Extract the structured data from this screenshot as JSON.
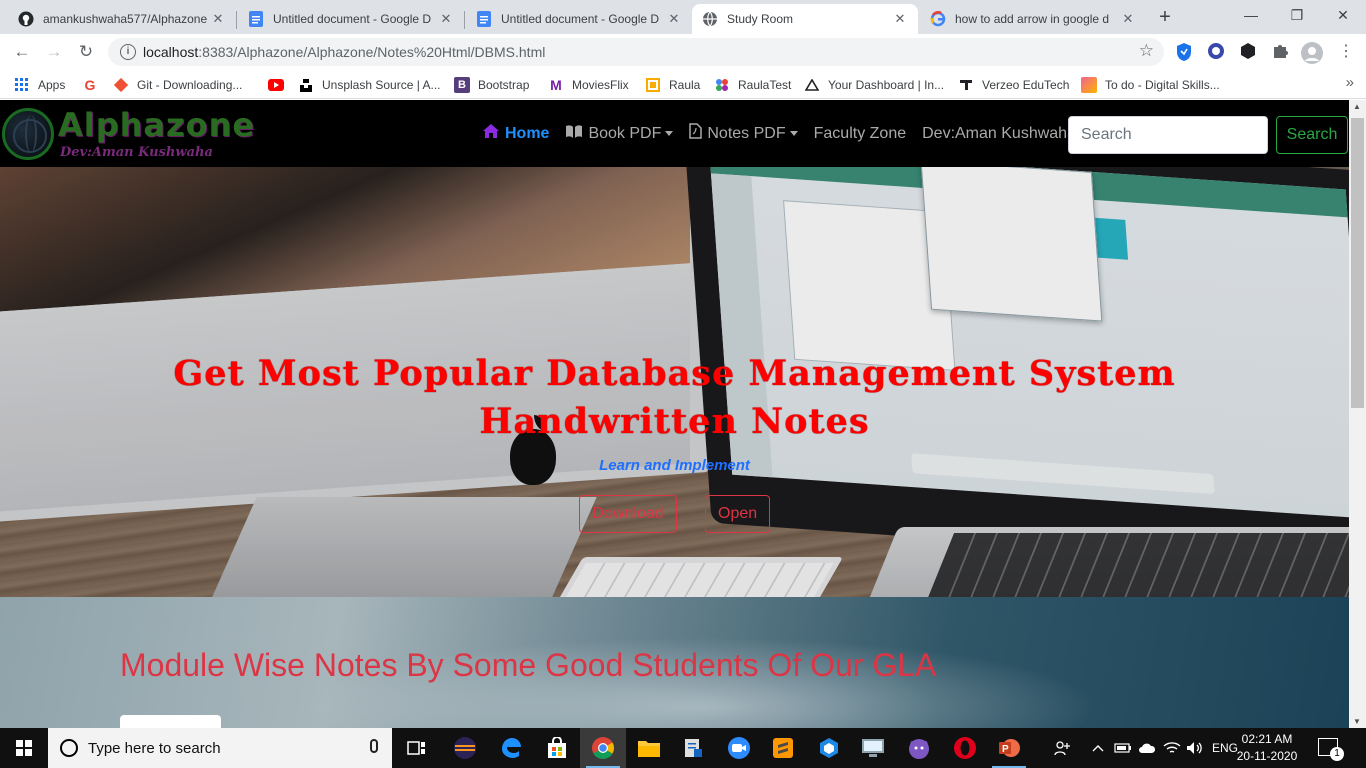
{
  "browser": {
    "tabs": [
      {
        "title": "amankushwaha577/Alphazone",
        "icon": "github-icon",
        "active": false
      },
      {
        "title": "Untitled document - Google D",
        "icon": "google-docs-icon",
        "active": false
      },
      {
        "title": "Untitled document - Google D",
        "icon": "google-docs-icon",
        "active": false
      },
      {
        "title": "Study Room",
        "icon": "globe-icon",
        "active": true
      },
      {
        "title": "how to add arrow in google d",
        "icon": "google-icon",
        "active": false
      }
    ],
    "url_host": "localhost",
    "url_rest": ":8383/Alphazone/Alphazone/Notes%20Html/DBMS.html",
    "bookmarks": [
      {
        "label": "Apps",
        "icon": "apps-grid-icon"
      },
      {
        "label": "",
        "icon": "google-icon"
      },
      {
        "label": "Git - Downloading...",
        "icon": "git-icon"
      },
      {
        "label": "",
        "icon": "youtube-icon"
      },
      {
        "label": "Unsplash Source | A...",
        "icon": "unsplash-icon"
      },
      {
        "label": "Bootstrap",
        "icon": "bootstrap-icon"
      },
      {
        "label": "MoviesFlix",
        "icon": "moviesflix-icon"
      },
      {
        "label": "Raula",
        "icon": "bookmark-icon"
      },
      {
        "label": "RaulaTest",
        "icon": "bookmark-icon"
      },
      {
        "label": "Your Dashboard | In...",
        "icon": "dashboard-icon"
      },
      {
        "label": "Verzeo EduTech",
        "icon": "verzeo-icon"
      },
      {
        "label": "To do - Digital Skills...",
        "icon": "todo-icon"
      }
    ]
  },
  "site": {
    "logo_title": "Alphazone",
    "logo_subtitle": "Dev:Aman Kushwaha",
    "nav": {
      "home": "Home",
      "book_pdf": "Book PDF",
      "notes_pdf": "Notes PDF",
      "faculty_zone": "Faculty Zone",
      "dev": "Dev:Aman Kushwaha"
    },
    "search_placeholder": "Search",
    "search_button": "Search"
  },
  "hero": {
    "title_line1": "Get Most Popular Database Management System",
    "title_line2": "Handwritten Notes",
    "tagline": "Learn and Implement",
    "download_button": "Download",
    "open_button": "Open"
  },
  "section": {
    "heading": "Module Wise Notes By Some Good Students Of Our GLA"
  },
  "taskbar": {
    "search_placeholder": "Type here to search",
    "language": "ENG",
    "time": "02:21 AM",
    "date": "20-11-2020",
    "notifications": "1"
  },
  "colors": {
    "accent_red": "#ff0000",
    "button_red": "#dc3545",
    "search_green": "#28a745",
    "home_blue": "#1e90ff"
  }
}
